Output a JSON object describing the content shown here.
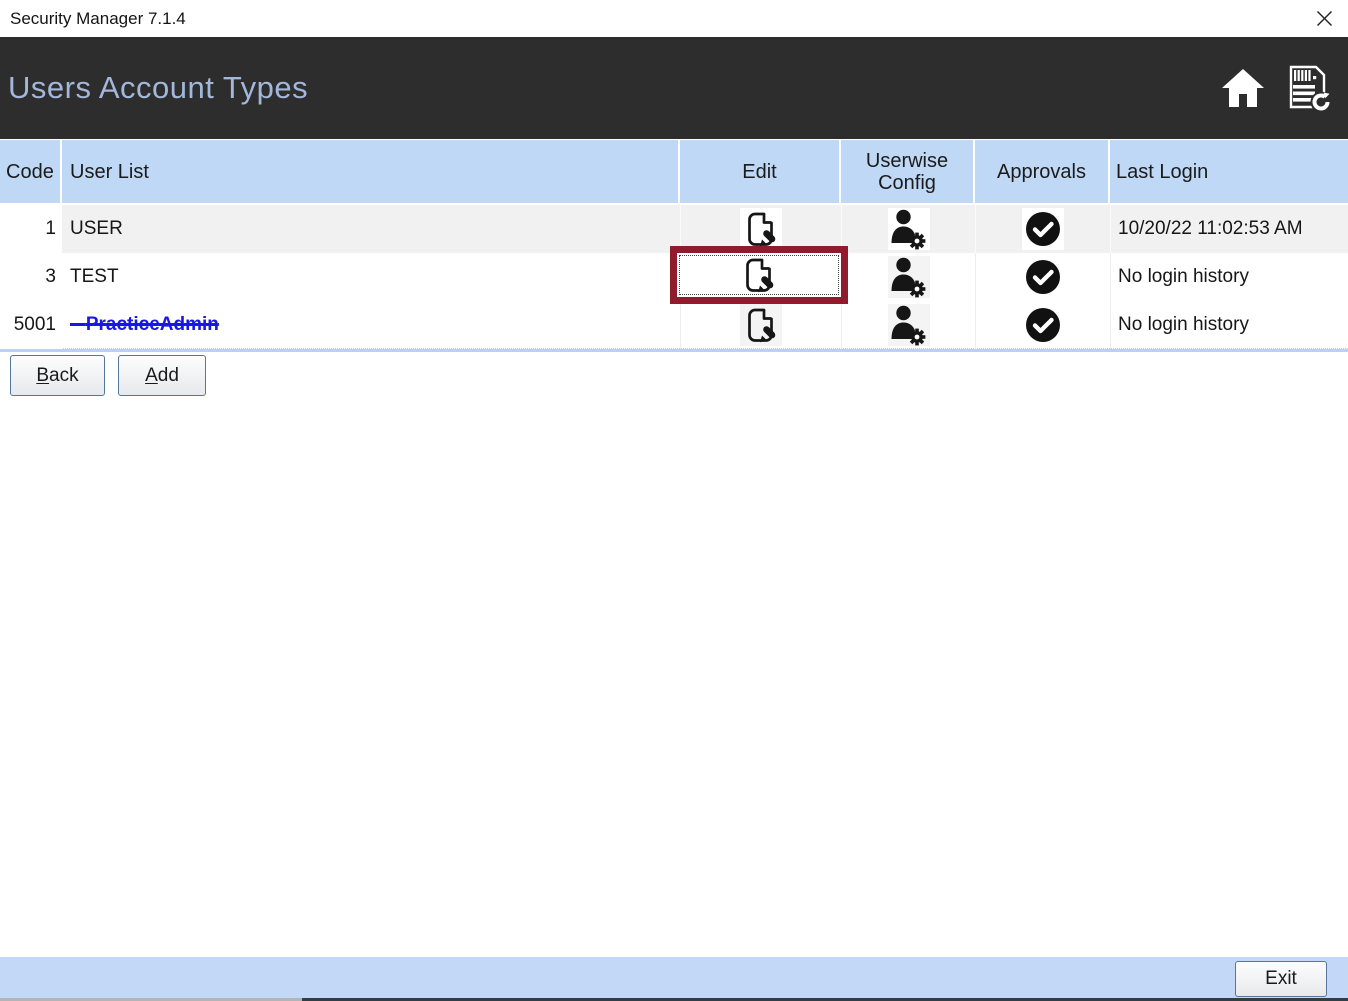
{
  "window": {
    "title": "Security Manager 7.1.4"
  },
  "header": {
    "title": "Users Account Types"
  },
  "table": {
    "columns": [
      {
        "label": "Code"
      },
      {
        "label": "User List"
      },
      {
        "label": "Edit"
      },
      {
        "label": "Userwise Config"
      },
      {
        "label": "Approvals"
      },
      {
        "label": "Last Login"
      }
    ],
    "rows": [
      {
        "code": "1",
        "user": "USER",
        "last_login": "10/20/22 11:02:53 AM"
      },
      {
        "code": "3",
        "user": "TEST",
        "last_login": "No login history"
      },
      {
        "code": "5001",
        "user": "PracticeAdmin",
        "last_login": "No login history"
      }
    ]
  },
  "actions": {
    "back": {
      "mnemonic": "B",
      "rest": "ack"
    },
    "add": {
      "mnemonic": "A",
      "rest": "dd"
    },
    "exit": {
      "label": "Exit"
    }
  },
  "icons": {
    "close": "close-icon",
    "home": "home-icon",
    "report_refresh": "report-refresh-icon",
    "edit": "edit-note-icon",
    "userwise_config": "user-gear-icon",
    "approvals": "check-circle-icon"
  },
  "colors": {
    "page_header_bg": "#2d2d2d",
    "page_header_text": "#a2b7d9",
    "table_header_bg": "#bed8f6",
    "row_stripe": "#f1f1f1",
    "highlight_border": "#8e1c2c",
    "deleted_link_blue": "#1a16e8",
    "bottom_bar_bg": "#c3d8f7"
  }
}
